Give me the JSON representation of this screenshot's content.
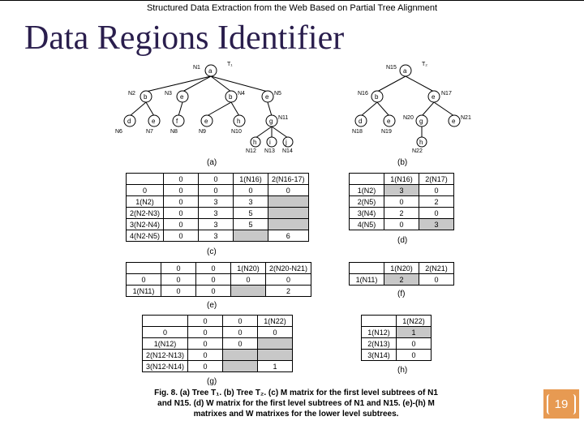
{
  "header": "Structured Data Extraction from the Web Based on Partial Tree Alignment",
  "title": "Data Regions Identifier",
  "page_number": "19",
  "trees": {
    "t1": {
      "title": "T₁",
      "root": {
        "id": "N1",
        "v": "a"
      },
      "level1": [
        {
          "id": "N2",
          "v": "b"
        },
        {
          "id": "N3",
          "v": "e"
        },
        {
          "id": "N4",
          "v": "b"
        },
        {
          "id": "N5",
          "v": "e"
        }
      ],
      "level2": [
        {
          "id": "N6",
          "v": "d"
        },
        {
          "id": "N7",
          "v": "e"
        },
        {
          "id": "N8",
          "v": "f"
        },
        {
          "id": "N9",
          "v": "e"
        },
        {
          "id": "N10",
          "v": "h"
        },
        {
          "id": "N11",
          "v": "g"
        }
      ],
      "level3": [
        {
          "id": "N12",
          "v": "h"
        },
        {
          "id": "N13",
          "v": "i"
        },
        {
          "id": "N14",
          "v": "j"
        }
      ]
    },
    "t2": {
      "title": "T₂",
      "root": {
        "id": "N15",
        "v": "a"
      },
      "level1": [
        {
          "id": "N16",
          "v": "b"
        },
        {
          "id": "N17",
          "v": "e"
        }
      ],
      "level2": [
        {
          "id": "N18",
          "v": "d"
        },
        {
          "id": "N19",
          "v": "e"
        },
        {
          "id": "N20",
          "v": "g"
        },
        {
          "id": "N21",
          "v": "e"
        }
      ],
      "level3": [
        {
          "id": "N22",
          "v": "h"
        }
      ]
    }
  },
  "tables": {
    "c": {
      "h": [
        "",
        "0",
        "0",
        "1(N16)",
        "2(N16-17)"
      ],
      "r": [
        [
          "0",
          "0",
          "0",
          "0",
          "0"
        ],
        [
          "1(N2)",
          "0",
          "3",
          "3",
          ""
        ],
        [
          "2(N2-N3)",
          "0",
          "3",
          "5",
          ""
        ],
        [
          "3(N2-N4)",
          "0",
          "3",
          "5",
          ""
        ],
        [
          "4(N2-N5)",
          "0",
          "3",
          "",
          "6"
        ]
      ]
    },
    "d": {
      "h": [
        "",
        "1(N16)",
        "2(N17)"
      ],
      "r": [
        [
          "1(N2)",
          "3",
          "0"
        ],
        [
          "2(N5)",
          "0",
          "2"
        ],
        [
          "3(N4)",
          "2",
          "0"
        ],
        [
          "4(N5)",
          "0",
          "3"
        ]
      ]
    },
    "e": {
      "h": [
        "",
        "0",
        "0",
        "1(N20)",
        "2(N20-N21)"
      ],
      "r": [
        [
          "0",
          "0",
          "0",
          "0",
          "0"
        ],
        [
          "1(N11)",
          "0",
          "0",
          "",
          "2"
        ]
      ]
    },
    "f": {
      "h": [
        "",
        "1(N20)",
        "2(N21)"
      ],
      "r": [
        [
          "1(N11)",
          "2",
          "0"
        ]
      ]
    },
    "g": {
      "h": [
        "",
        "0",
        "0",
        "1(N22)"
      ],
      "r": [
        [
          "0",
          "0",
          "0",
          "0"
        ],
        [
          "1(N12)",
          "0",
          "0",
          ""
        ],
        [
          "2(N12-N13)",
          "0",
          "",
          ""
        ],
        [
          "3(N12-N14)",
          "0",
          "",
          "1"
        ]
      ]
    },
    "h": {
      "h": [
        "",
        "1(N22)"
      ],
      "r": [
        [
          "1(N12)",
          "1"
        ],
        [
          "2(N13)",
          "0"
        ],
        [
          "3(N14)",
          "0"
        ]
      ]
    }
  },
  "sublabels": {
    "a": "(a)",
    "b": "(b)",
    "c": "(c)",
    "d": "(d)",
    "e": "(e)",
    "f": "(f)",
    "g": "(g)",
    "h": "(h)"
  },
  "caption": "Fig. 8. (a) Tree T₁. (b) Tree T₂. (c) M matrix for the first level subtrees of N1 and N15. (d) W matrix for the first level subtrees of N1 and N15. (e)-(h) M matrixes and W matrixes for the lower level subtrees."
}
